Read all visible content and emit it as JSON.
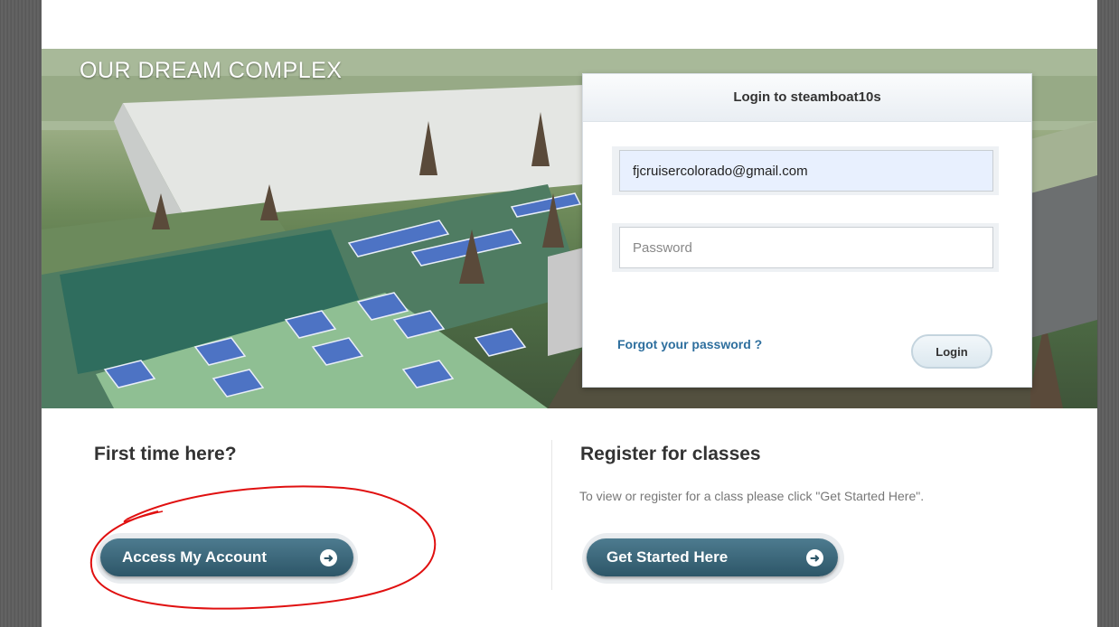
{
  "hero": {
    "title": "OUR DREAM COMPLEX"
  },
  "login": {
    "title": "Login to steamboat10s",
    "email_value": "fjcruisercolorado@gmail.com",
    "password_placeholder": "Password",
    "forgot_label": "Forgot your password ?",
    "login_label": "Login"
  },
  "first_time": {
    "heading": "First time here?",
    "button_label": "Access My Account"
  },
  "register": {
    "heading": "Register for classes",
    "description": "To view or register for a class please click \"Get Started Here\".",
    "button_label": "Get Started Here"
  },
  "colors": {
    "button_teal": "#3a6475",
    "link_blue": "#2e6f9e",
    "annotation_red": "#e01010"
  },
  "icons": {
    "arrow": "arrow-right-circle-icon"
  }
}
